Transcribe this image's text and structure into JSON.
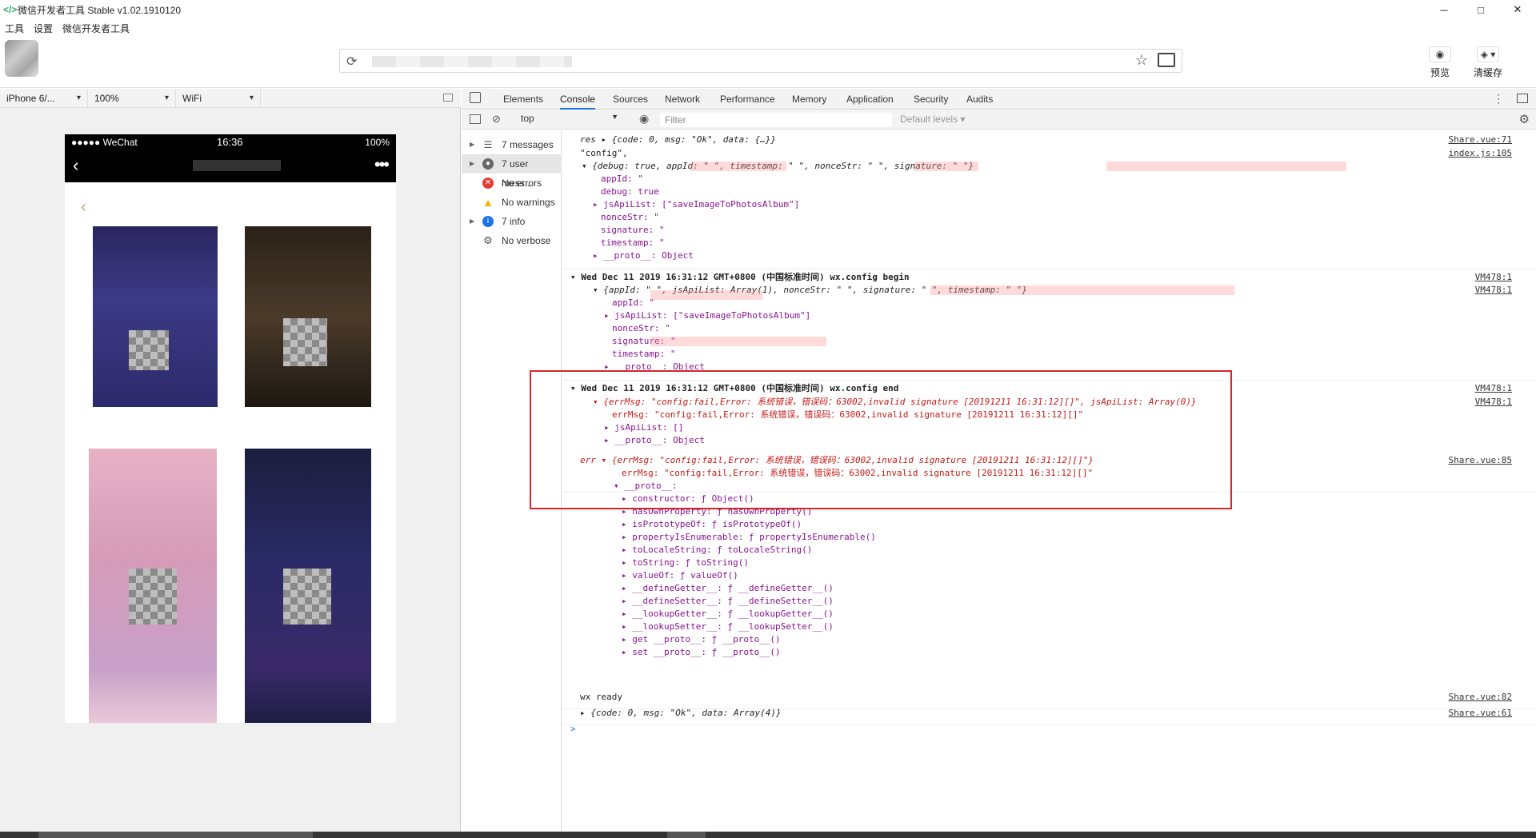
{
  "window": {
    "title": "微信开发者工具 Stable v1.02.1910120",
    "controls": [
      "─",
      "□",
      "✕"
    ]
  },
  "menu": [
    "工具",
    "设置",
    "微信开发者工具"
  ],
  "toolbar": {
    "preview_label": "预览",
    "clear_cache_label": "清缓存"
  },
  "simulator": {
    "device": "iPhone 6/...",
    "zoom": "100%",
    "network": "WiFi",
    "status": {
      "carrier": "●●●●● WeChat",
      "time": "16:36",
      "battery": "100%"
    }
  },
  "devtools": {
    "tabs": [
      "Elements",
      "Console",
      "Sources",
      "Network",
      "Performance",
      "Memory",
      "Application",
      "Security",
      "Audits"
    ],
    "active_tab": "Console",
    "context": "top",
    "filter_placeholder": "Filter",
    "levels": "Default levels ▾",
    "sidebar": [
      {
        "label": "7 messages",
        "icon": "list"
      },
      {
        "label": "7 user mess...",
        "icon": "user"
      },
      {
        "label": "No errors",
        "icon": "error"
      },
      {
        "label": "No warnings",
        "icon": "warning"
      },
      {
        "label": "7 info",
        "icon": "info"
      },
      {
        "label": "No verbose",
        "icon": "verbose"
      }
    ]
  },
  "console": {
    "lines": [
      {
        "text": "res ▸ {code: 0, msg: \"Ok\", data: {…}}",
        "src": "Share.vue:71"
      },
      {
        "text": "\"config\",",
        "src": "index.js:105"
      },
      {
        "text": "▾ {debug: true, appId: \"                \", timestamp: \"          \", nonceStr: \"          \", signature: \"                                \"}"
      },
      {
        "text": "appId: \""
      },
      {
        "text": "debug: true"
      },
      {
        "text": "▸ jsApiList: [\"saveImageToPhotosAlbum\"]"
      },
      {
        "text": "nonceStr: \""
      },
      {
        "text": "signature: \""
      },
      {
        "text": "timestamp: \""
      },
      {
        "text": "▸ __proto__: Object"
      },
      {
        "text": "▾ Wed Dec 11 2019 16:31:12 GMT+0800 (中国标准时间) wx.config begin",
        "src": "VM478:1"
      },
      {
        "text": "▾ {appId: \"              \", jsApiList: Array(1), nonceStr: \"          \", signature: \"                              \", timestamp: \"          \"}",
        "src": "VM478:1"
      },
      {
        "text": "appId: \""
      },
      {
        "text": "▸ jsApiList: [\"saveImageToPhotosAlbum\"]"
      },
      {
        "text": "nonceStr: \""
      },
      {
        "text": "signature: \""
      },
      {
        "text": "timestamp: \""
      },
      {
        "text": "▸ __proto__: Object"
      },
      {
        "text": "▾ Wed Dec 11 2019 16:31:12 GMT+0800 (中国标准时间) wx.config end",
        "src": "VM478:1"
      },
      {
        "text": "▾ {errMsg: \"config:fail,Error: 系统错误，错误码：63002,invalid signature [20191211 16:31:12][]\", jsApiList: Array(0)}",
        "src": "VM478:1"
      },
      {
        "text": "errMsg: \"config:fail,Error: 系统错误，错误码：63002,invalid signature [20191211 16:31:12][]\""
      },
      {
        "text": "▸ jsApiList: []"
      },
      {
        "text": "▸ __proto__: Object"
      },
      {
        "text": "err ▾ {errMsg: \"config:fail,Error: 系统错误，错误码：63002,invalid signature [20191211 16:31:12][]\"}",
        "src": "Share.vue:85"
      },
      {
        "text": "errMsg: \"config:fail,Error: 系统错误，错误码：63002,invalid signature [20191211 16:31:12][]\""
      },
      {
        "text": "▾ __proto__:"
      },
      {
        "text": "▸ constructor: ƒ Object()"
      },
      {
        "text": "▸ hasOwnProperty: ƒ hasOwnProperty()"
      },
      {
        "text": "▸ isPrototypeOf: ƒ isPrototypeOf()"
      },
      {
        "text": "▸ propertyIsEnumerable: ƒ propertyIsEnumerable()"
      },
      {
        "text": "▸ toLocaleString: ƒ toLocaleString()"
      },
      {
        "text": "▸ toString: ƒ toString()"
      },
      {
        "text": "▸ valueOf: ƒ valueOf()"
      },
      {
        "text": "▸ __defineGetter__: ƒ __defineGetter__()"
      },
      {
        "text": "▸ __defineSetter__: ƒ __defineSetter__()"
      },
      {
        "text": "▸ __lookupGetter__: ƒ __lookupGetter__()"
      },
      {
        "text": "▸ __lookupSetter__: ƒ __lookupSetter__()"
      },
      {
        "text": "▸ get __proto__: ƒ __proto__()"
      },
      {
        "text": "▸ set __proto__: ƒ __proto__()"
      },
      {
        "text": "wx ready",
        "src": "Share.vue:82"
      },
      {
        "text": "▸ {code: 0, msg: \"Ok\", data: Array(4)}",
        "src": "Share.vue:61"
      },
      {
        "text": ">"
      }
    ]
  },
  "colors": {
    "highlight_box": "#d9232a",
    "link_active": "#1a73e8"
  }
}
